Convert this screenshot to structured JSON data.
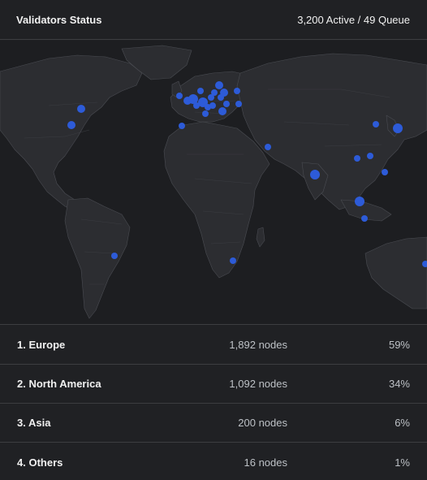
{
  "header": {
    "title": "Validators Status",
    "status": "3,200 Active / 49 Queue"
  },
  "colors": {
    "background": "#202124",
    "land": "#2c2d31",
    "border": "#4a4c52",
    "dot": "#2d5bd8"
  },
  "regions": [
    {
      "name": "1. Europe",
      "nodes": "1,892 nodes",
      "percent": "59%"
    },
    {
      "name": "2. North America",
      "nodes": "1,092 nodes",
      "percent": "34%"
    },
    {
      "name": "3. Asia",
      "nodes": "200 nodes",
      "percent": "6%"
    },
    {
      "name": "4. Others",
      "nodes": "16 nodes",
      "percent": "1%"
    }
  ]
}
